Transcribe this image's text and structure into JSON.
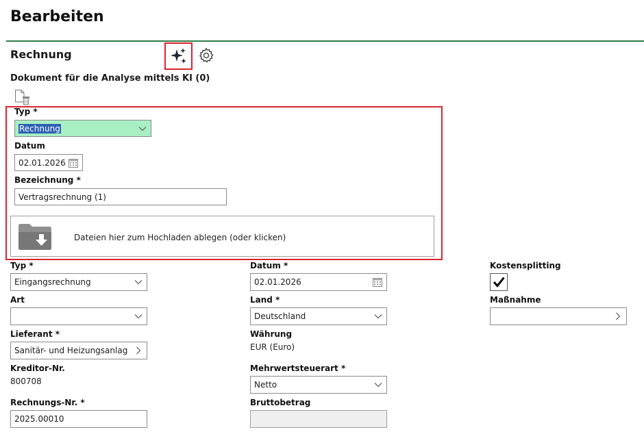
{
  "page": {
    "title": "Bearbeiten"
  },
  "section": {
    "title": "Rechnung",
    "ai_icon": "sparkle-icon",
    "settings_icon": "gear-icon"
  },
  "document": {
    "heading": "Dokument für die Analyse mittels KI (0)",
    "icon": "file-delete-icon",
    "type_label": "Typ *",
    "type_value": "Rechnung",
    "date_label": "Datum",
    "date_value": "02.01.2026",
    "name_label": "Bezeichnung *",
    "name_value": "Vertragsrechnung (1)",
    "upload_text": "Dateien hier zum Hochladen ablegen (oder klicken)"
  },
  "form": {
    "typ_label": "Typ *",
    "typ_value": "Eingangsrechnung",
    "art_label": "Art",
    "art_value": "",
    "lieferant_label": "Lieferant *",
    "lieferant_value": "Sanitär- und Heizungsanlag",
    "kreditor_label": "Kreditor-Nr.",
    "kreditor_value": "800708",
    "rechnungsnr_label": "Rechnungs-Nr. *",
    "rechnungsnr_value": "2025.00010",
    "datum_label": "Datum *",
    "datum_value": "02.01.2026",
    "land_label": "Land *",
    "land_value": "Deutschland",
    "waehrung_label": "Währung",
    "waehrung_value": "EUR (Euro)",
    "mwst_label": "Mehrwertsteuerart *",
    "mwst_value": "Netto",
    "brutto_label": "Bruttobetrag",
    "brutto_value": "",
    "kosten_label": "Kostensplitting",
    "kosten_checked": true,
    "massnahme_label": "Maßnahme",
    "massnahme_value": ""
  },
  "colors": {
    "accent_rule": "#2e7d46",
    "highlight_border": "#d9232d",
    "selected_field": "#a8efc4",
    "selection": "#2d62b4"
  }
}
